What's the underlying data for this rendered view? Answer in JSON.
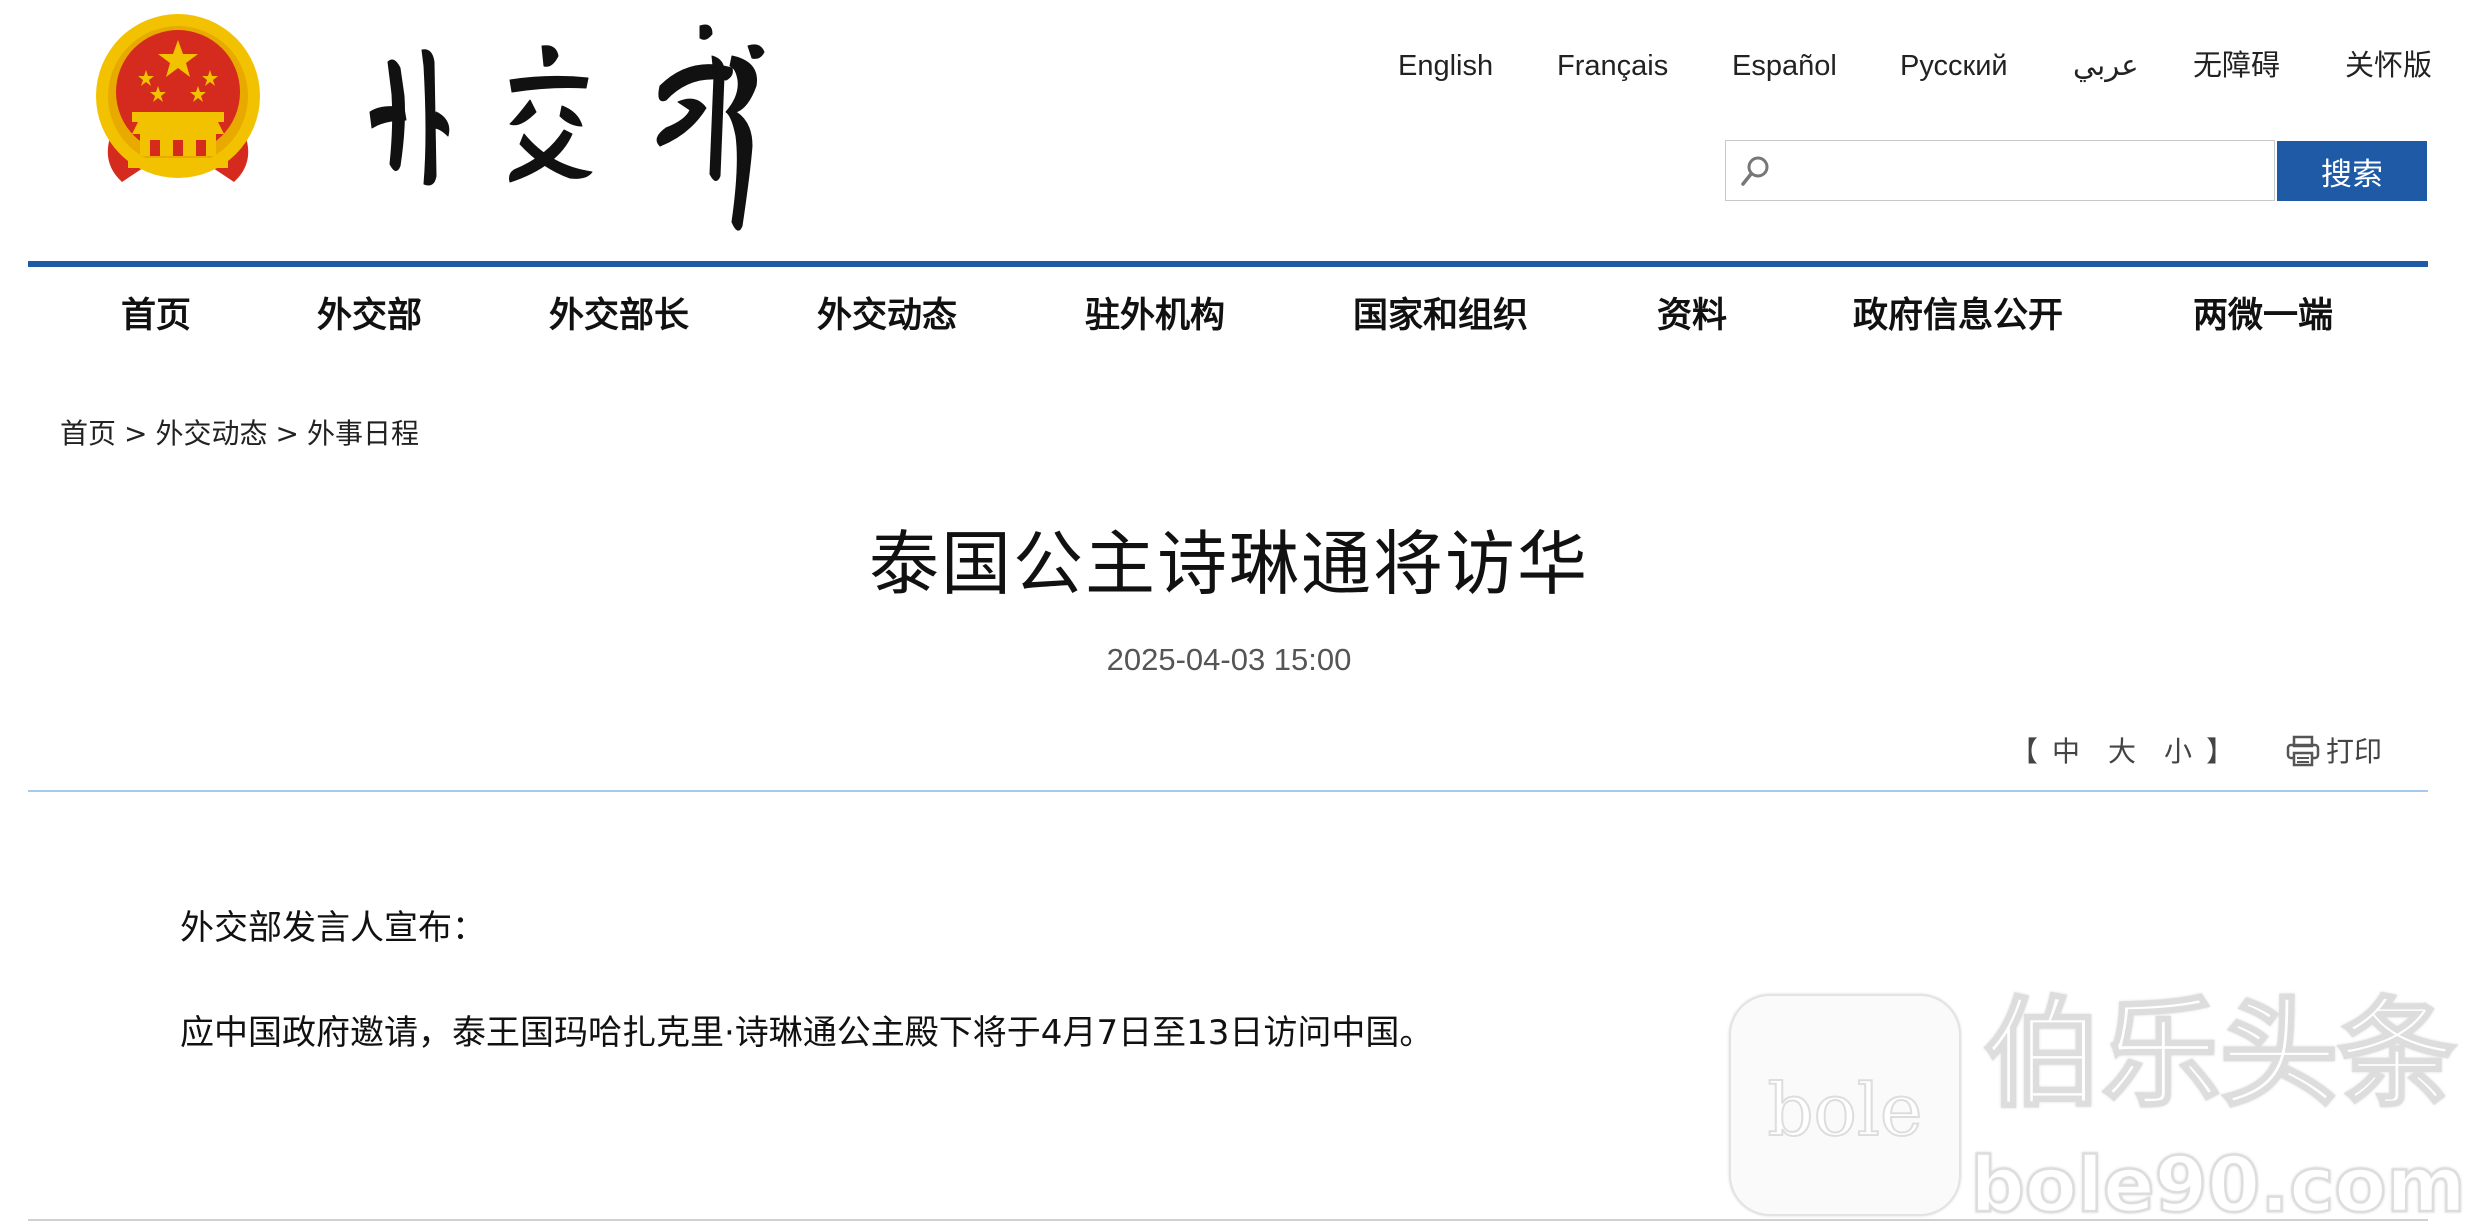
{
  "header": {
    "emblem_icon": "national-emblem-icon",
    "logo_text": "外交部",
    "languages": [
      {
        "label": "English"
      },
      {
        "label": "Français"
      },
      {
        "label": "Español"
      },
      {
        "label": "Русский"
      },
      {
        "label": "عربي"
      },
      {
        "label": "无障碍"
      },
      {
        "label": "关怀版"
      }
    ],
    "search": {
      "icon": "search-icon",
      "placeholder": "",
      "value": "",
      "button_label": "搜索"
    }
  },
  "nav": {
    "items": [
      {
        "label": "首页"
      },
      {
        "label": "外交部"
      },
      {
        "label": "外交部长"
      },
      {
        "label": "外交动态"
      },
      {
        "label": "驻外机构"
      },
      {
        "label": "国家和组织"
      },
      {
        "label": "资料"
      },
      {
        "label": "政府信息公开"
      },
      {
        "label": "两微一端"
      }
    ]
  },
  "breadcrumb": {
    "items": [
      {
        "label": "首页"
      },
      {
        "label": "外交动态"
      },
      {
        "label": "外事日程"
      }
    ],
    "separator": ">"
  },
  "article": {
    "title": "泰国公主诗琳通将访华",
    "date": "2025-04-03 15:00",
    "font_size": {
      "open_bracket": "【",
      "options": [
        "中",
        "大",
        "小"
      ],
      "close_bracket": "】"
    },
    "print": {
      "icon": "printer-icon",
      "label": "打印"
    },
    "paragraphs": [
      "外交部发言人宣布：",
      "应中国政府邀请，泰王国玛哈扎克里·诗琳通公主殿下将于4月7日至13日访问中国。"
    ]
  },
  "watermark": {
    "badge_text": "bole",
    "main_text": "伯乐头条",
    "url_text": "bole90.com"
  },
  "colors": {
    "nav_rule": "#1f5aa6",
    "search_button": "#1f5aa6",
    "content_rule": "#a9c9ec",
    "emblem_red": "#d52b1e",
    "emblem_gold": "#f2c200"
  }
}
